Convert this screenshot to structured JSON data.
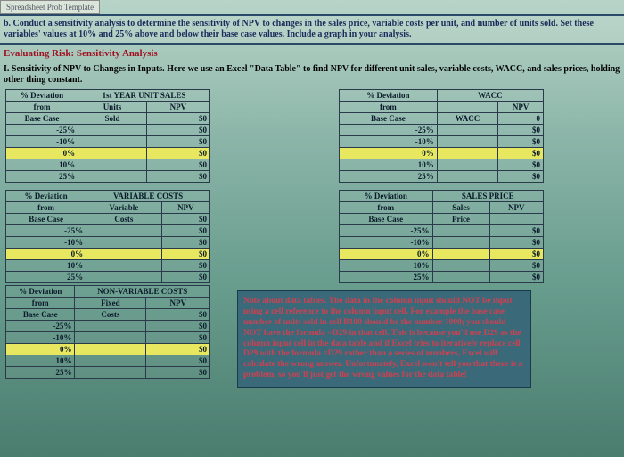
{
  "tab": "Spreadsheet Prob Template",
  "section_b": "b. Conduct a sensitivity analysis to determine the sensitivity of NPV to changes in the sales price, variable costs per unit, and number of units sold. Set these variables' values at 10% and 25% above and below their base case values. Include a graph in your analysis.",
  "heading_red": "Evaluating Risk: Sensitivity Analysis",
  "heading_black": "I. Sensitivity of NPV to Changes in Inputs.  Here we use an Excel \"Data Table\" to find NPV for different unit sales, variable costs, WACC, and sales prices, holding other thing constant.",
  "deviations": [
    "-25%",
    "-10%",
    "0%",
    "10%",
    "25%"
  ],
  "tables": {
    "unit_sales": {
      "title": "1st YEAR UNIT SALES",
      "col1_l1": "% Deviation",
      "col1_l2": "from",
      "col1_l3": "Base Case",
      "col2_l2": "Units",
      "col2_l3": "Sold",
      "col3_l2": "NPV",
      "col3_l3": "$0",
      "values": [
        "$0",
        "$0",
        "$0",
        "$0",
        "$0"
      ]
    },
    "wacc": {
      "title": "WACC",
      "col1_l1": "% Deviation",
      "col1_l2": "from",
      "col1_l3": "Base Case",
      "col2_l3": "WACC",
      "col3_l2": "NPV",
      "col3_l3": "0",
      "values": [
        "$0",
        "$0",
        "$0",
        "$0",
        "$0"
      ]
    },
    "variable_costs": {
      "title": "VARIABLE COSTS",
      "col1_l1": "% Deviation",
      "col1_l2": "from",
      "col1_l3": "Base Case",
      "col2_l2": "Variable",
      "col2_l3": "Costs",
      "col3_l2": "NPV",
      "col3_l3": "$0",
      "values": [
        "$0",
        "$0",
        "$0",
        "$0",
        "$0"
      ]
    },
    "sales_price": {
      "title": "SALES PRICE",
      "col1_l1": "% Deviation",
      "col1_l2": "from",
      "col1_l3": "Base Case",
      "col2_l2": "Sales",
      "col2_l3": "Price",
      "col3_l2": "NPV",
      "col3_l3": "",
      "values": [
        "$0",
        "$0",
        "$0",
        "$0",
        "$0"
      ]
    },
    "nonvar_costs": {
      "title": "NON-VARIABLE COSTS",
      "col1_l1": "% Deviation",
      "col1_l2": "from",
      "col1_l3": "Base Case",
      "col2_l2": "Fixed",
      "col2_l3": "Costs",
      "col3_l2": "NPV",
      "col3_l3": "$0",
      "values": [
        "$0",
        "$0",
        "$0",
        "$0",
        "$0"
      ]
    }
  },
  "note": "Note about data tables. The data in the column input should NOT be input using a cell reference to the column input cell. For example the base case number of units sold in cell B100 should be the number 1000; you should NOT have the formula =D29 in that cell. This is because you'll use D29 as the column input cell in the data table and if Excel tries to iteratively replace cell D29 with the formula =D29 rather than a series of numbers, Excel will calculate the wrong answer. Unfortunately, Excel won't tell you that there is a problem, so you'll just get the wrong values for the data table!"
}
